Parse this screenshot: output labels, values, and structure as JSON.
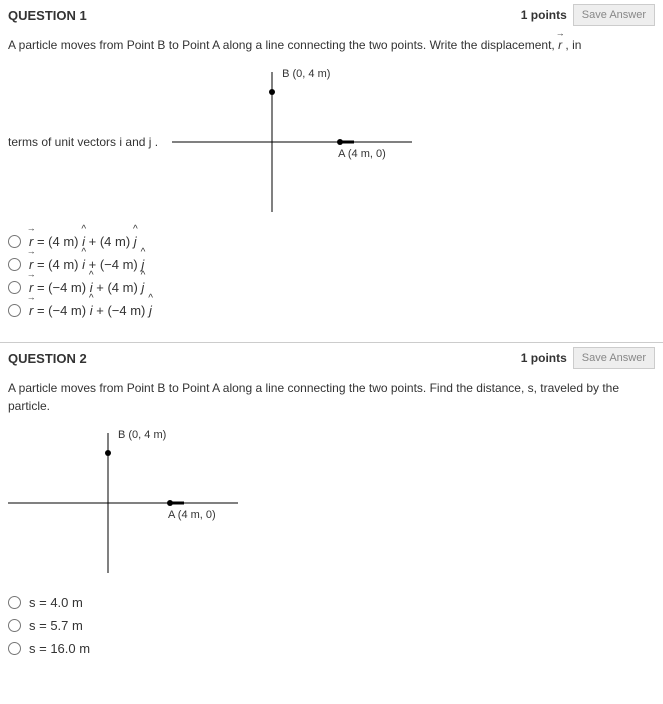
{
  "q1": {
    "title": "QUESTION 1",
    "points": "1 points",
    "save": "Save Answer",
    "prompt_pre": "A particle moves from Point B to Point A along a line connecting the two points. Write the displacement, ",
    "vec_r": "r",
    "prompt_post": ", in",
    "left_text_pre": "terms of unit vectors ",
    "ihat": "i",
    "and": " and ",
    "jhat": "j",
    "period": ".",
    "labelB": "B (0, 4 m)",
    "labelA": "A (4 m, 0)",
    "options": {
      "opt1": {
        "r": "r",
        "eq": "= (4 m) ",
        "i": "i",
        "plus": "+ (4 m) ",
        "j": "j"
      },
      "opt2": {
        "r": "r",
        "eq": "= (4 m) ",
        "i": "i",
        "plus": "+ (−4 m) ",
        "j": "j"
      },
      "opt3": {
        "r": "r",
        "eq": "= (−4 m) ",
        "i": "i",
        "plus": "+ (4 m) ",
        "j": "j"
      },
      "opt4": {
        "r": "r",
        "eq": "= (−4 m) ",
        "i": "i",
        "plus": "+ (−4 m) ",
        "j": "j"
      }
    }
  },
  "q2": {
    "title": "QUESTION 2",
    "points": "1 points",
    "save": "Save Answer",
    "prompt": "A particle moves from Point B to Point A along a line connecting the two points. Find the distance, s, traveled by the particle.",
    "labelB": "B (0, 4 m)",
    "labelA": "A (4 m, 0)",
    "options": {
      "opt1": "s = 4.0 m",
      "opt2": "s = 5.7 m",
      "opt3": "s = 16.0 m"
    }
  }
}
